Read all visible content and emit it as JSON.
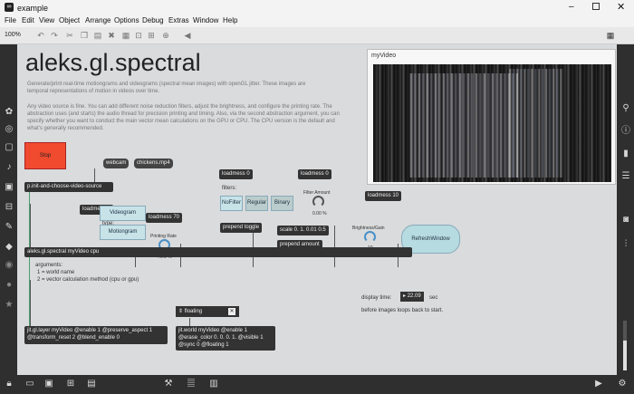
{
  "window": {
    "title": "example"
  },
  "menu": [
    "File",
    "Edit",
    "View",
    "Object",
    "Arrange",
    "Options",
    "Debug",
    "Extras",
    "Window",
    "Help"
  ],
  "toolbar": {
    "zoom": "100%"
  },
  "patch": {
    "title": "aleks.gl.spectral",
    "desc1": "Generate/print real-time motiongrams and videograms (spectral mean images) with openGL jitter. These images are temporal representations of motion in videos over time.",
    "desc2": "Any video source is fine. You can add different noise reduction filters, adjust the brightness, and configure the printing rate. The abstraction uses (and starts) the audio thread for precision printing and timing. Also, via the second abstraction argument, you can specify whether you want to conduct the main vector mean calculations on the GPU or CPU. The CPU version is the default and what's generally recommended.",
    "stop": "Stop",
    "webcam": "webcam",
    "chickens": "chickens.mp4",
    "pinit": "p.init-and-choose-video-source",
    "loadmess1": "loadmess 1",
    "type": "type:",
    "videogram": "Videogram",
    "motiongram": "Motiongram",
    "loadmess70": "loadmess 70",
    "printing_rate": "Printing Rate",
    "printing_val": "70.0 %",
    "loadmess0a": "loadmess 0",
    "filters": "filters:",
    "nofilter": "NoFilter",
    "regular": "Regular",
    "binary": "Binary",
    "prepend_toggle": "prepend toggle",
    "loadmess0b": "loadmess 0",
    "filter_amount": "Filter Amount",
    "filter_val": "0.00 %",
    "scale": "scale 0. 1. 0.01 0.5",
    "prepend_amount": "prepend amount",
    "loadmess10": "loadmess 10",
    "brightness": "Brightness/Gain",
    "brightness_val": "10",
    "refresh": "RefreshWindow",
    "main_obj": "aleks.gl.spectral myVideo cpu",
    "arguments": "arguments:",
    "arg1": "1 = world name",
    "arg2": "2 = vector calculation method (cpu or gpu)",
    "display_time": "display time:",
    "display_val": "22.09",
    "sec": "sec",
    "before_loops": "before images loops back to start.",
    "floating": "floating",
    "jitlayer": "jit.gl.layer myVideo @enable 1 @preserve_aspect 1 @transform_reset 2 @blend_enable 0",
    "jitworld": "jit.world myVideo @enable 1 @erase_color 0. 0. 0. 1. @visible 1 @sync 0 @floating 1",
    "video_title": "myVideo"
  }
}
